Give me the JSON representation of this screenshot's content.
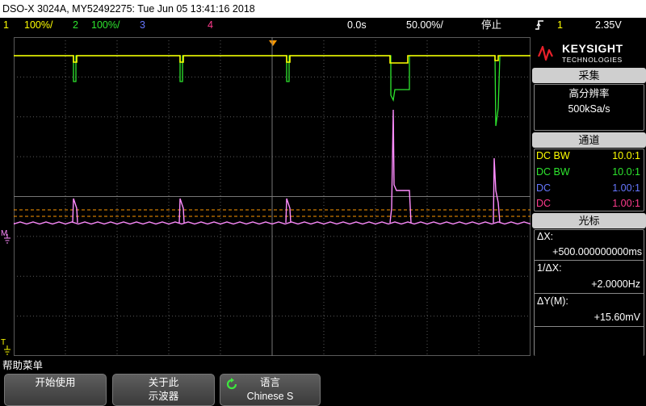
{
  "title": "DSO-X 3024A, MY52492275: Tue Jun 05 13:41:16 2018",
  "status": {
    "ch1_num": "1",
    "ch1_scale": "100%/",
    "ch2_num": "2",
    "ch2_scale": "100%/",
    "ch3_num": "3",
    "ch4_num": "4",
    "delay": "0.0s",
    "timebase": "50.00%/",
    "run_state": "停止",
    "trigger_icon": "trigger-rising-edge-icon",
    "trigger_source": "1",
    "trigger_level": "2.35V"
  },
  "brand": {
    "name": "KEYSIGHT",
    "sub": "TECHNOLOGIES"
  },
  "acquire": {
    "header": "采集",
    "mode": "高分辨率",
    "rate": "500kSa/s"
  },
  "channels": {
    "header": "通道",
    "rows": [
      {
        "coupling": "DC BW",
        "ratio": "10.0:1",
        "color": "#ffff00"
      },
      {
        "coupling": "DC BW",
        "ratio": "10.0:1",
        "color": "#2ee62e"
      },
      {
        "coupling": "DC",
        "ratio": "1.00:1",
        "color": "#6677ff"
      },
      {
        "coupling": "DC",
        "ratio": "1.00:1",
        "color": "#ff3b8d"
      }
    ]
  },
  "cursors": {
    "header": "光标",
    "dx_label": "ΔX:",
    "dx_value": "+500.000000000ms",
    "inv_dx_label": "1/ΔX:",
    "inv_dx_value": "+2.0000Hz",
    "dy_label": "ΔY(M):",
    "dy_value": "+15.60mV"
  },
  "markers": {
    "math": "M",
    "trigger": "T"
  },
  "softkeys": {
    "menu_title": "帮助菜单",
    "k1": "开始使用",
    "k2_line1": "关于此",
    "k2_line2": "示波器",
    "k3_line1": "语言",
    "k3_line2": "Chinese S"
  },
  "colors": {
    "ch1": "#ffff00",
    "ch2": "#2ee62e",
    "math": "#ff8cff",
    "grid": "#5a5a5a",
    "cursor": "#ff9900"
  }
}
